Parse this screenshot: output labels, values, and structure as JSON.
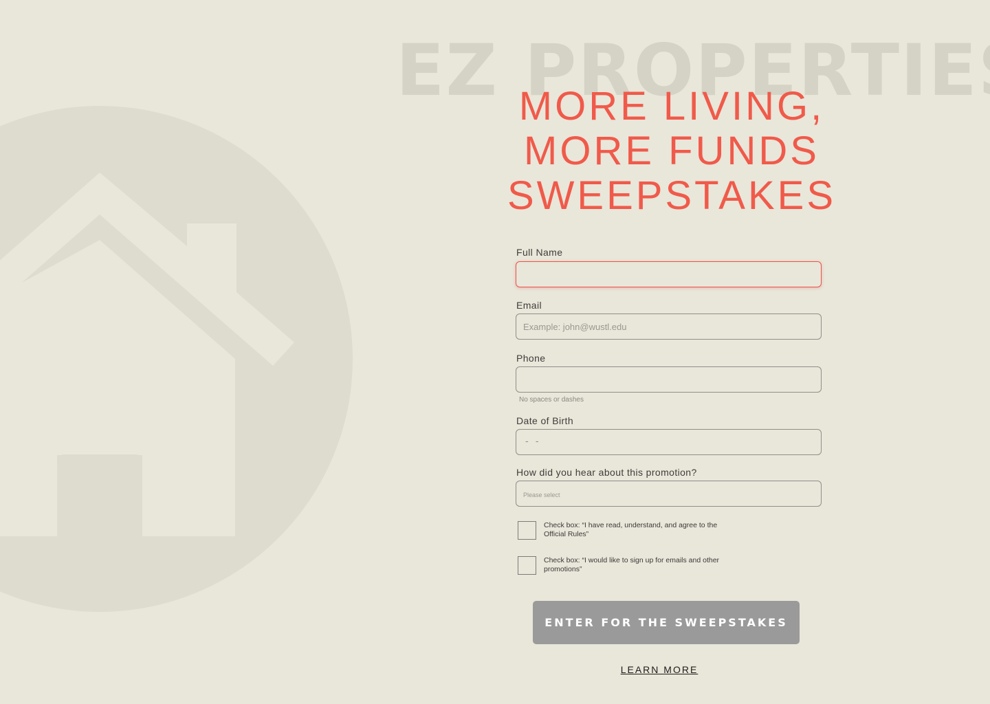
{
  "brand": {
    "name": "EZ PROPERTIES",
    "logo_icon": "house-icon"
  },
  "headline": {
    "line1": "MORE LIVING,",
    "line2": "MORE FUNDS",
    "line3": "SWEEPSTAKES"
  },
  "form": {
    "full_name": {
      "label": "Full Name",
      "value": "",
      "placeholder": ""
    },
    "email": {
      "label": "Email",
      "value": "",
      "placeholder": "Example: john@wustl.edu"
    },
    "phone": {
      "label": "Phone",
      "value": "",
      "placeholder": "",
      "hint": "No spaces or dashes"
    },
    "dob": {
      "label": "Date of Birth",
      "value": "",
      "placeholder": "- -"
    },
    "source": {
      "label": "How did you hear about this promotion?",
      "selected": "",
      "placeholder": "Please select"
    },
    "checkbox_rules": {
      "label": "Check box: “I have read, understand, and agree to the Official Rules”",
      "checked": false
    },
    "checkbox_emails": {
      "label": "Check box: “I would like to sign up for emails and other promotions”",
      "checked": false
    },
    "submit_label": "ENTER FOR THE SWEEPSTAKES",
    "learn_more": "LEARN MORE"
  },
  "colors": {
    "background": "#e9e6da",
    "accent": "#f05a4a",
    "watermark": "#d5d2c6",
    "logo_circle": "#dedbcf",
    "button": "#9a9a9a"
  }
}
